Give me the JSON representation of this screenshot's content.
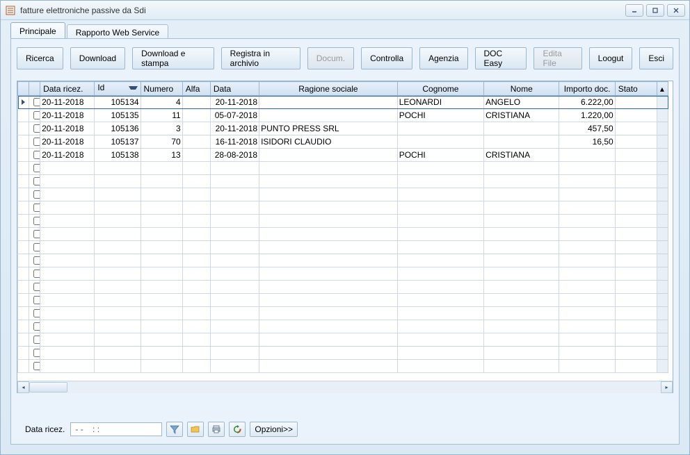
{
  "window": {
    "title": "fatture elettroniche passive da Sdi"
  },
  "tabs": [
    {
      "label": "Principale",
      "selected": true
    },
    {
      "label": "Rapporto Web Service",
      "selected": false
    }
  ],
  "toolbar": {
    "ricerca": "Ricerca",
    "download": "Download",
    "download_stampa": "Download e stampa",
    "registra": "Registra in archivio",
    "docum": "Docum.",
    "controlla": "Controlla",
    "agenzia": "Agenzia",
    "doc_easy": "DOC Easy",
    "edita_file": "Edita File",
    "loogut": "Loogut",
    "esci": "Esci"
  },
  "grid": {
    "headers": {
      "data_ricez": "Data ricez.",
      "id": "Id",
      "numero": "Numero",
      "alfa": "Alfa",
      "data": "Data",
      "ragione_sociale": "Ragione sociale",
      "cognome": "Cognome",
      "nome": "Nome",
      "importo_doc": "Importo doc.",
      "stato": "Stato"
    },
    "rows": [
      {
        "data_ricez": "20-11-2018",
        "id": "105134",
        "numero": "4",
        "alfa": "",
        "data": "20-11-2018",
        "ragione": "",
        "cognome": "LEONARDI",
        "nome": "ANGELO",
        "importo": "6.222,00",
        "stato": ""
      },
      {
        "data_ricez": "20-11-2018",
        "id": "105135",
        "numero": "11",
        "alfa": "",
        "data": "05-07-2018",
        "ragione": "",
        "cognome": "POCHI",
        "nome": "CRISTIANA",
        "importo": "1.220,00",
        "stato": ""
      },
      {
        "data_ricez": "20-11-2018",
        "id": "105136",
        "numero": "3",
        "alfa": "",
        "data": "20-11-2018",
        "ragione": "PUNTO PRESS SRL",
        "cognome": "",
        "nome": "",
        "importo": "457,50",
        "stato": ""
      },
      {
        "data_ricez": "20-11-2018",
        "id": "105137",
        "numero": "70",
        "alfa": "",
        "data": "16-11-2018",
        "ragione": "ISIDORI CLAUDIO",
        "cognome": "",
        "nome": "",
        "importo": "16,50",
        "stato": ""
      },
      {
        "data_ricez": "20-11-2018",
        "id": "105138",
        "numero": "13",
        "alfa": "",
        "data": "28-08-2018",
        "ragione": "",
        "cognome": "POCHI",
        "nome": "CRISTIANA",
        "importo": "",
        "stato": ""
      }
    ]
  },
  "footer": {
    "label": "Data ricez.",
    "value": "- -    : :",
    "opzioni": "Opzioni>>"
  },
  "icons": {
    "filter": "filter-icon",
    "folder": "folder-icon",
    "print": "print-icon",
    "refresh": "refresh-icon"
  }
}
